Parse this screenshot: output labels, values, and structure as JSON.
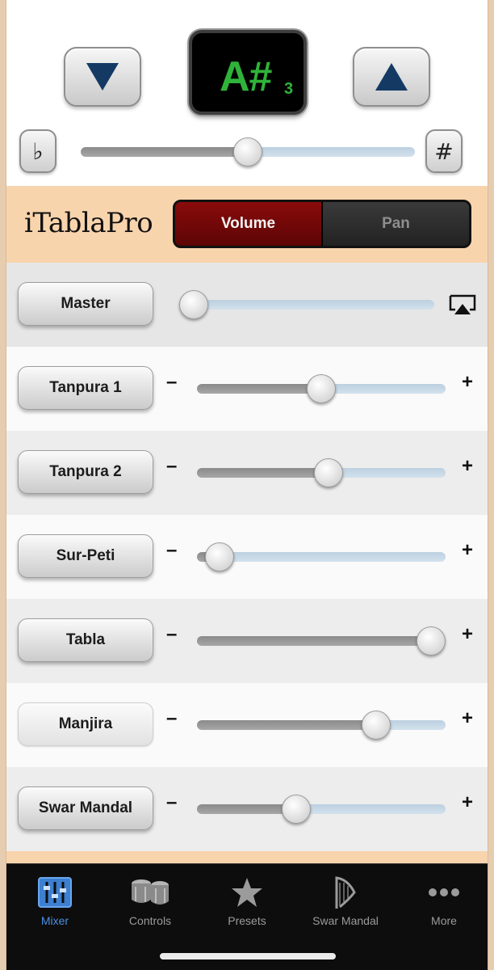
{
  "tuning": {
    "note": "A#",
    "octave": "3",
    "flat_symbol": "♭",
    "sharp_symbol": "#",
    "fine_tune_value": 0.5
  },
  "header": {
    "brand": "iTablaPro",
    "segments": [
      "Volume",
      "Pan"
    ],
    "selected_segment": "Volume"
  },
  "mixer": {
    "minus_symbol": "–",
    "plus_symbol": "+",
    "master": {
      "label": "Master",
      "value": 0.0
    },
    "channels": [
      {
        "label": "Tanpura 1",
        "value": 0.5
      },
      {
        "label": "Tanpura 2",
        "value": 0.53
      },
      {
        "label": "Sur-Peti",
        "value": 0.09
      },
      {
        "label": "Tabla",
        "value": 0.95
      },
      {
        "label": "Manjira",
        "value": 0.72
      },
      {
        "label": "Swar Mandal",
        "value": 0.4
      }
    ]
  },
  "tabbar": {
    "items": [
      {
        "label": "Mixer",
        "icon": "mixer-icon",
        "active": true
      },
      {
        "label": "Controls",
        "icon": "drums-icon",
        "active": false
      },
      {
        "label": "Presets",
        "icon": "star-icon",
        "active": false
      },
      {
        "label": "Swar Mandal",
        "icon": "harp-icon",
        "active": false
      },
      {
        "label": "More",
        "icon": "more-dots-icon",
        "active": false
      }
    ]
  },
  "colors": {
    "note_green": "#2fb33a",
    "arrow_navy": "#143a63",
    "header_peach": "#f8d4ad",
    "segment_active": "#7a0a0a",
    "tab_active": "#4a8fe0"
  }
}
